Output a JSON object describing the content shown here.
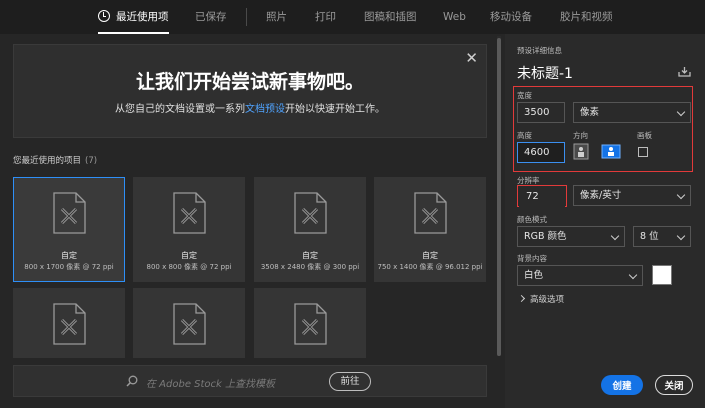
{
  "tabs": [
    {
      "label": "最近使用项",
      "active": true
    },
    {
      "label": "已保存",
      "active": false
    },
    {
      "label": "照片",
      "active": false
    },
    {
      "label": "打印",
      "active": false
    },
    {
      "label": "图稿和插图",
      "active": false
    },
    {
      "label": "Web",
      "active": false
    },
    {
      "label": "移动设备",
      "active": false
    },
    {
      "label": "胶片和视频",
      "active": false
    }
  ],
  "hero": {
    "title": "让我们开始尝试新事物吧。",
    "subtitle_pre": "从您自己的文档设置或一系列",
    "subtitle_link": "文档预设",
    "subtitle_post": "开始以快速开始工作。"
  },
  "recent": {
    "label": "您最近使用的项目",
    "count": "(7)",
    "items": [
      {
        "name": "自定",
        "size": "800 x 1700 像素 @ 72 ppi"
      },
      {
        "name": "自定",
        "size": "800 x 800 像素 @ 72 ppi"
      },
      {
        "name": "自定",
        "size": "3508 x 2480 像素 @ 300 ppi"
      },
      {
        "name": "自定",
        "size": "750 x 1400 像素 @ 96.012 ppi"
      }
    ]
  },
  "stock": {
    "placeholder": "在 Adobe Stock 上查找模板",
    "go_label": "前往"
  },
  "preset": {
    "section_label": "预设详细信息",
    "title": "未标题-1",
    "width_label": "宽度",
    "width_value": "3500",
    "width_unit": "像素",
    "height_label": "高度",
    "height_value": "4600",
    "orientation_label": "方向",
    "artboard_label": "画板",
    "resolution_label": "分辨率",
    "resolution_value": "72",
    "resolution_unit": "像素/英寸",
    "color_mode_label": "颜色模式",
    "color_mode_value": "RGB 颜色",
    "bit_depth_value": "8 位",
    "background_label": "背景内容",
    "background_value": "白色",
    "advanced_label": "高级选项",
    "create_label": "创建",
    "close_label": "关闭"
  },
  "colors": {
    "accent": "#1473e6",
    "highlight_box": "#e23a3a",
    "selected_border": "#2e8ff7",
    "link": "#4fa3ff"
  }
}
